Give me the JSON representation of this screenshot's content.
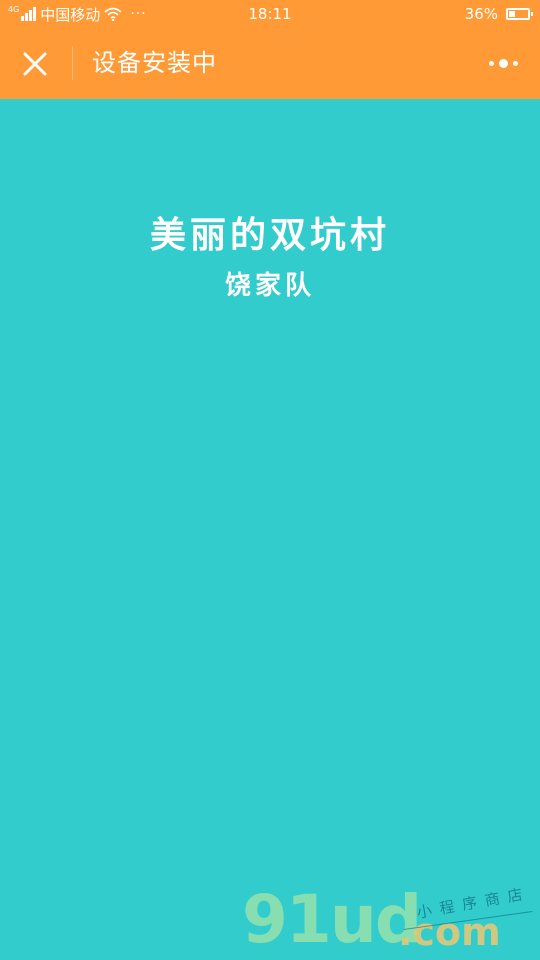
{
  "status_bar": {
    "network_tag": "4G",
    "carrier": "中国移动",
    "more_indicator": "···",
    "time": "18:11",
    "battery_percent": "36%",
    "battery_level": 0.36
  },
  "nav_bar": {
    "title": "设备安装中",
    "close_icon": "close-icon",
    "more_icon": "more-dots-icon",
    "background_color": "#FF9A36"
  },
  "content": {
    "title": "美丽的双坑村",
    "subtitle": "饶家队",
    "background_color": "#33CCCC"
  },
  "watermark": {
    "main": "91ud",
    "domain": ".com",
    "tagline": "小程序商店"
  }
}
